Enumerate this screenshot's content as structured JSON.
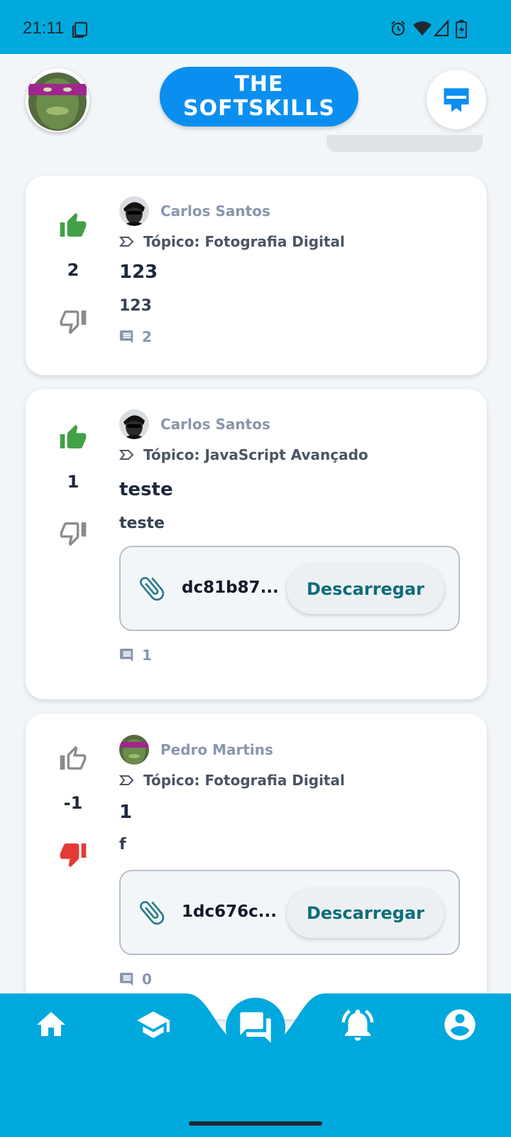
{
  "status_bar": {
    "time": "21:11"
  },
  "header": {
    "brand_line1": "THE",
    "brand_line2": "SOFTSKILLS"
  },
  "colors": {
    "accent": "#00a9dd",
    "brand": "#0a8ff0",
    "upvote_active": "#43a047",
    "downvote_active": "#e53935",
    "download_text": "#0e6e78"
  },
  "posts": [
    {
      "votes": "2",
      "upvoted": true,
      "downvoted": false,
      "author": "Carlos Santos",
      "topic": "Tópico: Fotografia Digital",
      "title": "123",
      "body": "123",
      "comments": "2",
      "attachment": null
    },
    {
      "votes": "1",
      "upvoted": true,
      "downvoted": false,
      "author": "Carlos Santos",
      "topic": "Tópico: JavaScript Avançado",
      "title": "teste",
      "body": "teste",
      "comments": "1",
      "attachment": {
        "name": "dc81b87...",
        "action": "Descarregar"
      }
    },
    {
      "votes": "-1",
      "upvoted": false,
      "downvoted": true,
      "author": "Pedro Martins",
      "topic": "Tópico: Fotografia Digital",
      "title": "1",
      "body": "f",
      "comments": "0",
      "attachment": {
        "name": "1dc676c...",
        "action": "Descarregar"
      }
    }
  ],
  "bottom_nav": {
    "items": [
      "home-icon",
      "courses-icon",
      "forum-icon",
      "notifications-icon",
      "profile-icon"
    ],
    "active": "forum-icon"
  }
}
